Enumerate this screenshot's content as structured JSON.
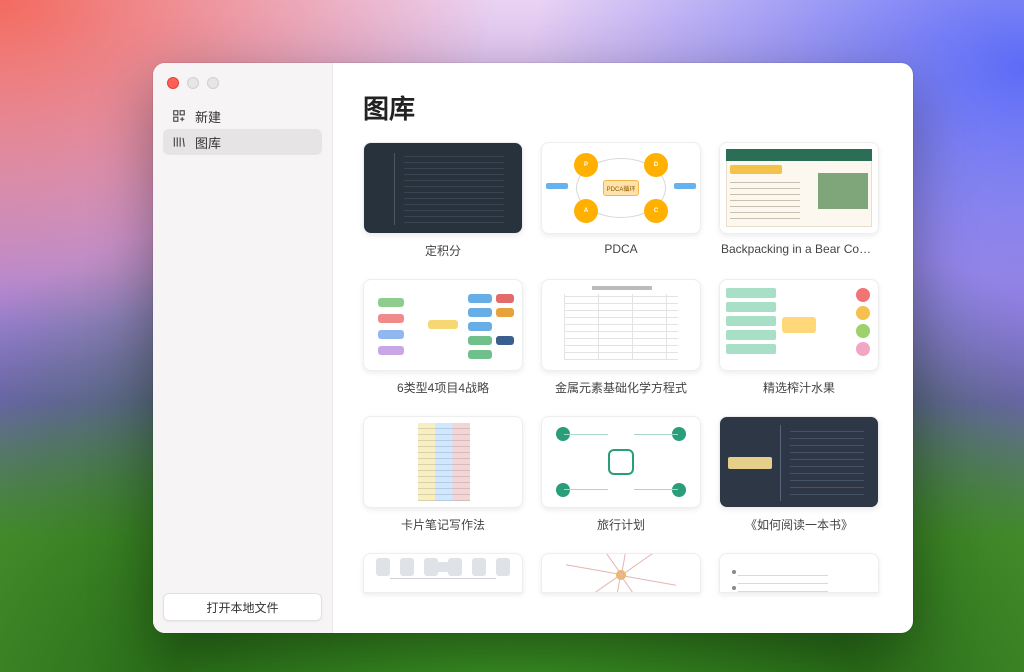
{
  "sidebar": {
    "items": [
      {
        "label": "新建"
      },
      {
        "label": "图库"
      }
    ],
    "open_local_label": "打开本地文件"
  },
  "main": {
    "title": "图库",
    "gallery": [
      {
        "title": "定积分"
      },
      {
        "title": "PDCA"
      },
      {
        "title": "Backpacking in a Bear Country"
      },
      {
        "title": "6类型4项目4战略"
      },
      {
        "title": "金属元素基础化学方程式"
      },
      {
        "title": "精选榨汁水果"
      },
      {
        "title": "卡片笔记写作法"
      },
      {
        "title": "旅行计划"
      },
      {
        "title": "《如何阅读一本书》"
      },
      {
        "title": ""
      },
      {
        "title": ""
      },
      {
        "title": ""
      }
    ],
    "pdca_center": "PDCA循环"
  }
}
